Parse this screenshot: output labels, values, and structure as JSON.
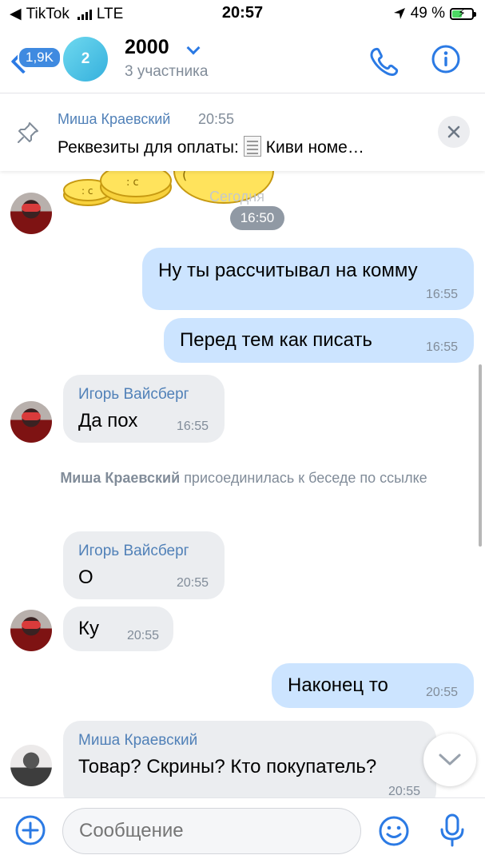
{
  "status_bar": {
    "back_app": "TikTok",
    "network": "LTE",
    "time": "20:57",
    "battery": "49 %",
    "battery_level": 0.49
  },
  "header": {
    "back_badge": "1,9K",
    "avatar_text": "2",
    "title": "2000",
    "subtitle": "3 участника",
    "accent_color": "#2b7ae4"
  },
  "pinned": {
    "author": "Миша Краевский",
    "time": "20:55",
    "text_before": "Реквезиты для оплаты:",
    "text_after": "Киви номе…"
  },
  "chat": {
    "date_label": "Сегодня",
    "time_pill": "16:50",
    "messages": [
      {
        "direction": "out",
        "text": "Ну ты рассчитывал на комму",
        "time": "16:55"
      },
      {
        "direction": "out",
        "text": "Перед тем как писать",
        "time": "16:55"
      },
      {
        "direction": "in",
        "author": "Игорь Вайсберг",
        "text": "Да пох",
        "time": "16:55"
      },
      {
        "direction": "in",
        "author": "Игорь Вайсберг",
        "text": "О",
        "time": "20:55"
      },
      {
        "direction": "in",
        "text": "Ку",
        "time": "20:55"
      },
      {
        "direction": "out",
        "text": "Наконец то",
        "time": "20:55"
      },
      {
        "direction": "in",
        "author": "Миша Краевский",
        "text": "Товар? Скрины? Кто покупатель?",
        "time": "20:55"
      }
    ],
    "service": {
      "name": "Миша Краевский",
      "text": "присоединилась к беседе по ссылке"
    }
  },
  "composer": {
    "placeholder": "Сообщение"
  },
  "icons": {
    "back": "chevron-left-icon",
    "call": "phone-icon",
    "info": "info-icon",
    "pin": "pin-icon",
    "close": "close-icon",
    "attach": "plus-circle-icon",
    "emoji": "smile-icon",
    "mic": "microphone-icon",
    "scroll": "chevron-down-icon"
  }
}
